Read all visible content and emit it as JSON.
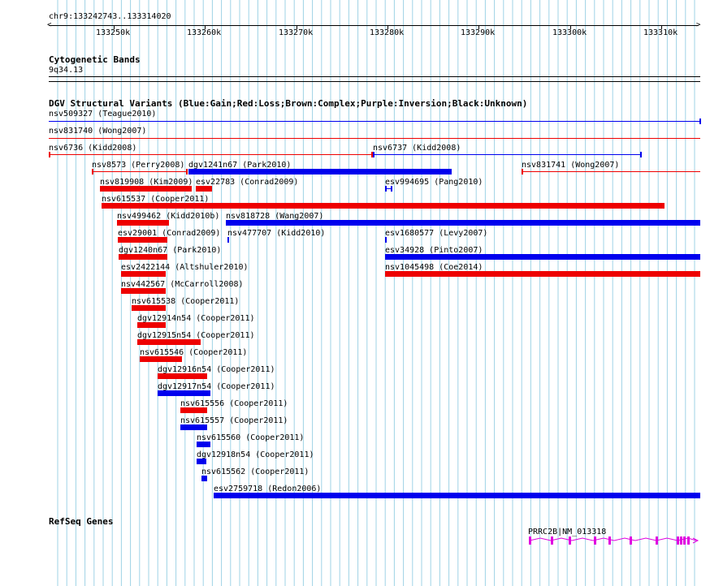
{
  "ruler": {
    "location": "chr9:133242743..133314020",
    "ticks": [
      "133250k",
      "133260k",
      "133270k",
      "133280k",
      "133290k",
      "133300k",
      "133310k"
    ]
  },
  "cyto": {
    "title": "Cytogenetic Bands",
    "band": "9q34.13"
  },
  "dgv": {
    "title": "DGV Structural Variants (Blue:Gain;Red:Loss;Brown:Complex;Purple:Inversion;Black:Unknown)",
    "features": [
      {
        "label": "nsv509327 (Teague2010)",
        "color": "blue",
        "style": "line"
      },
      {
        "label": "nsv831740 (Wong2007)",
        "color": "red",
        "style": "line"
      },
      {
        "label": "nsv6736 (Kidd2008)",
        "color": "red",
        "style": "line"
      },
      {
        "label": "nsv6737 (Kidd2008)",
        "color": "blue",
        "style": "line"
      },
      {
        "label": "nsv8573 (Perry2008)",
        "color": "red",
        "style": "line"
      },
      {
        "label": "dgv1241n67 (Park2010)",
        "color": "blue",
        "style": "bar"
      },
      {
        "label": "nsv831741 (Wong2007)",
        "color": "red",
        "style": "line"
      },
      {
        "label": "nsv819908 (Kim2009)",
        "color": "red",
        "style": "bar"
      },
      {
        "label": "esv22783 (Conrad2009)",
        "color": "red",
        "style": "bar"
      },
      {
        "label": "esv994695 (Pang2010)",
        "color": "blue",
        "style": "bracket"
      },
      {
        "label": "nsv615537 (Cooper2011)",
        "color": "red",
        "style": "bar"
      },
      {
        "label": "nsv499462 (Kidd2010b)",
        "color": "red",
        "style": "bar"
      },
      {
        "label": "nsv818728 (Wang2007)",
        "color": "blue",
        "style": "bar"
      },
      {
        "label": "esv29001 (Conrad2009)",
        "color": "red",
        "style": "bar"
      },
      {
        "label": "nsv477707 (Kidd2010)",
        "color": "blue",
        "style": "tick"
      },
      {
        "label": "esv1680577 (Levy2007)",
        "color": "blue",
        "style": "tick"
      },
      {
        "label": "dgv1240n67 (Park2010)",
        "color": "red",
        "style": "bar"
      },
      {
        "label": "esv34928 (Pinto2007)",
        "color": "blue",
        "style": "bar"
      },
      {
        "label": "esv2422144 (Altshuler2010)",
        "color": "red",
        "style": "bar"
      },
      {
        "label": "nsv1045498 (Coe2014)",
        "color": "red",
        "style": "bar"
      },
      {
        "label": "nsv442567 (McCarroll2008)",
        "color": "red",
        "style": "bar"
      },
      {
        "label": "nsv615538 (Cooper2011)",
        "color": "red",
        "style": "bar"
      },
      {
        "label": "dgv12914n54 (Cooper2011)",
        "color": "red",
        "style": "bar"
      },
      {
        "label": "dgv12915n54 (Cooper2011)",
        "color": "red",
        "style": "bar"
      },
      {
        "label": "nsv615546 (Cooper2011)",
        "color": "red",
        "style": "bar"
      },
      {
        "label": "dgv12916n54 (Cooper2011)",
        "color": "red",
        "style": "bar"
      },
      {
        "label": "dgv12917n54 (Cooper2011)",
        "color": "blue",
        "style": "bar"
      },
      {
        "label": "nsv615556 (Cooper2011)",
        "color": "red",
        "style": "bar"
      },
      {
        "label": "nsv615557 (Cooper2011)",
        "color": "blue",
        "style": "bar"
      },
      {
        "label": "nsv615560 (Cooper2011)",
        "color": "blue",
        "style": "bar"
      },
      {
        "label": "dgv12918n54 (Cooper2011)",
        "color": "blue",
        "style": "bar"
      },
      {
        "label": "nsv615562 (Cooper2011)",
        "color": "blue",
        "style": "bar"
      },
      {
        "label": "esv2759718 (Redon2006)",
        "color": "blue",
        "style": "bar"
      }
    ]
  },
  "refseq": {
    "title": "RefSeq Genes",
    "gene_label": "PRRC2B|NM_013318",
    "color": "#e000e0"
  },
  "colors": {
    "gain": "#0000ee",
    "loss": "#ee0000",
    "grid": "#9fd3e6",
    "gene": "#e000e0"
  }
}
